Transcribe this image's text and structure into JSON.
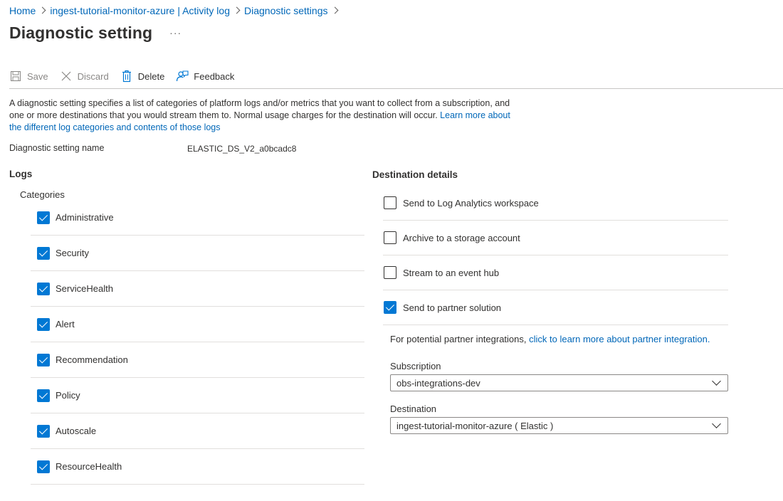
{
  "breadcrumb": {
    "items": [
      "Home",
      "ingest-tutorial-monitor-azure | Activity log",
      "Diagnostic settings"
    ]
  },
  "page": {
    "title": "Diagnostic setting",
    "more": "···"
  },
  "toolbar": {
    "save": "Save",
    "discard": "Discard",
    "delete": "Delete",
    "feedback": "Feedback"
  },
  "description": {
    "text": "A diagnostic setting specifies a list of categories of platform logs and/or metrics that you want to collect from a subscription, and one or more destinations that you would stream them to. Normal usage charges for the destination will occur. ",
    "link": "Learn more about the different log categories and contents of those logs"
  },
  "setting_name": {
    "label": "Diagnostic setting name",
    "value": "ELASTIC_DS_V2_a0bcadc8"
  },
  "logs": {
    "heading": "Logs",
    "categories_label": "Categories",
    "categories": [
      {
        "label": "Administrative",
        "checked": true
      },
      {
        "label": "Security",
        "checked": true
      },
      {
        "label": "ServiceHealth",
        "checked": true
      },
      {
        "label": "Alert",
        "checked": true
      },
      {
        "label": "Recommendation",
        "checked": true
      },
      {
        "label": "Policy",
        "checked": true
      },
      {
        "label": "Autoscale",
        "checked": true
      },
      {
        "label": "ResourceHealth",
        "checked": true
      }
    ]
  },
  "destination": {
    "heading": "Destination details",
    "options": [
      {
        "label": "Send to Log Analytics workspace",
        "checked": false
      },
      {
        "label": "Archive to a storage account",
        "checked": false
      },
      {
        "label": "Stream to an event hub",
        "checked": false
      },
      {
        "label": "Send to partner solution",
        "checked": true
      }
    ],
    "partner_note": "For potential partner integrations, ",
    "partner_link": "click to learn more about partner integration.",
    "subscription_label": "Subscription",
    "subscription_value": "obs-integrations-dev",
    "destination_label": "Destination",
    "destination_value": "ingest-tutorial-monitor-azure ( Elastic )"
  },
  "colors": {
    "link": "#0067b8",
    "accent": "#0078d4",
    "text": "#323130",
    "disabled": "#8a8886"
  }
}
